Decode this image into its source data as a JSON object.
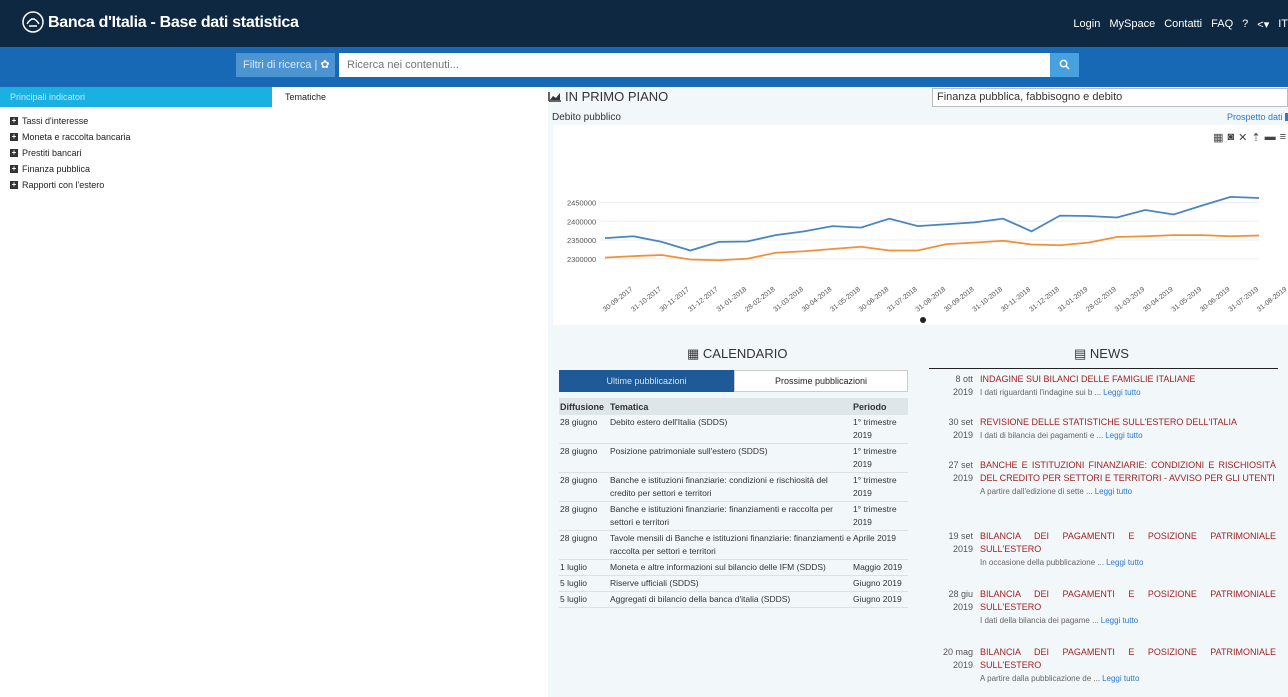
{
  "header": {
    "title": "Banca d'Italia - Base dati statistica",
    "nav": [
      "Login",
      "MySpace",
      "Contatti",
      "FAQ",
      "?",
      "<▾",
      "IT"
    ]
  },
  "search": {
    "filter_label": "Filtri di ricerca |",
    "placeholder": "Ricerca nei contenuti..."
  },
  "left": {
    "tab_indicatori": "Principali indicatori",
    "tab_tematiche": "Tematiche",
    "items": [
      "Tassi d'interesse",
      "Moneta e raccolta bancaria",
      "Prestiti bancari",
      "Finanza pubblica",
      "Rapporti con l'estero"
    ]
  },
  "primo_piano": {
    "title": "IN PRIMO PIANO",
    "select_value": "Finanza pubblica, fabbisogno e debito",
    "chart_title": "Debito pubblico",
    "prospetto_link": "Prospetto dati"
  },
  "chart_data": {
    "type": "line",
    "x": [
      "30-09-2017",
      "31-10-2017",
      "30-11-2017",
      "31-12-2017",
      "31-01-2018",
      "28-02-2018",
      "31-03-2018",
      "30-04-2018",
      "31-05-2018",
      "30-06-2018",
      "31-07-2018",
      "31-08-2018",
      "30-09-2018",
      "31-10-2018",
      "30-11-2018",
      "31-12-2018",
      "31-01-2019",
      "28-02-2019",
      "31-03-2019",
      "30-04-2019",
      "31-05-2019",
      "30-06-2019",
      "31-07-2019",
      "31-08-2019"
    ],
    "ytick_labels": [
      "2300000",
      "2350000",
      "2400000",
      "2450000"
    ],
    "ylim": [
      2270000,
      2470000
    ],
    "series": [
      {
        "color": "#4a86be",
        "values": [
          2355000,
          2360000,
          2345000,
          2322000,
          2345000,
          2346000,
          2363000,
          2373000,
          2387000,
          2383000,
          2407000,
          2387000,
          2392000,
          2397000,
          2407000,
          2373000,
          2415000,
          2414000,
          2410000,
          2430000,
          2418000,
          2442000,
          2465000,
          2462000
        ]
      },
      {
        "color": "#f0913a",
        "values": [
          2303000,
          2307000,
          2310000,
          2298000,
          2296000,
          2300000,
          2316000,
          2320000,
          2326000,
          2332000,
          2322000,
          2322000,
          2339000,
          2343000,
          2348000,
          2338000,
          2336000,
          2343000,
          2358000,
          2360000,
          2363000,
          2363000,
          2360000,
          2362000
        ]
      }
    ]
  },
  "calendario": {
    "title": "CALENDARIO",
    "tab_active": "Ultime pubblicazioni",
    "tab_other": "Prossime pubblicazioni",
    "headers": [
      "Diffusione",
      "Tematica",
      "Periodo"
    ],
    "rows": [
      [
        "28 giugno",
        "Debito estero dell'Italia (SDDS)",
        "1° trimestre 2019"
      ],
      [
        "28 giugno",
        "Posizione patrimoniale sull'estero (SDDS)",
        "1° trimestre 2019"
      ],
      [
        "28 giugno",
        "Banche e istituzioni finanziarie: condizioni e rischiosità del credito per settori e territori",
        "1° trimestre 2019"
      ],
      [
        "28 giugno",
        "Banche e istituzioni finanziarie: finanziamenti e raccolta per settori e territori",
        "1° trimestre 2019"
      ],
      [
        "28 giugno",
        "Tavole mensili di Banche e istituzioni finanziarie: finanziamenti e raccolta per settori e territori",
        "Aprile 2019"
      ],
      [
        "1 luglio",
        "Moneta e altre informazioni sul bilancio delle IFM (SDDS)",
        "Maggio 2019"
      ],
      [
        "5 luglio",
        "Riserve ufficiali (SDDS)",
        "Giugno 2019"
      ],
      [
        "5 luglio",
        "Aggregati di bilancio della banca d'italia (SDDS)",
        "Giugno 2019"
      ]
    ]
  },
  "news": {
    "title": "NEWS",
    "leggi": "Leggi tutto",
    "items": [
      {
        "date1": "8 ott",
        "date2": "2019",
        "head": "INDAGINE SUI BILANCI DELLE FAMIGLIE ITALIANE",
        "desc": "I dati riguardanti l'indagine sui b ..."
      },
      {
        "date1": "30 set",
        "date2": "2019",
        "head": "REVISIONE DELLE STATISTICHE SULL'ESTERO DELL'ITALIA",
        "desc": "I dati di bilancia dei pagamenti e ..."
      },
      {
        "date1": "27 set",
        "date2": "2019",
        "head": "BANCHE E ISTITUZIONI FINANZIARIE: CONDIZIONI E RISCHIOSITÀ DEL CREDITO PER SETTORI E TERRITORI - AVVISO PER GLI UTENTI",
        "desc": "A partire dall'edizione di sette ..."
      },
      {
        "date1": "19 set",
        "date2": "2019",
        "head": "BILANCIA DEI PAGAMENTI E POSIZIONE PATRIMONIALE SULL'ESTERO",
        "desc": "In occasione della pubblicazione ..."
      },
      {
        "date1": "28 giu",
        "date2": "2019",
        "head": "BILANCIA DEI PAGAMENTI E POSIZIONE PATRIMONIALE SULL'ESTERO",
        "desc": "I dati della bilancia dei pagame ..."
      },
      {
        "date1": "20 mag",
        "date2": "2019",
        "head": "BILANCIA DEI PAGAMENTI E POSIZIONE PATRIMONIALE SULL'ESTERO",
        "desc": "A partire dalla pubblicazione de ..."
      }
    ]
  }
}
